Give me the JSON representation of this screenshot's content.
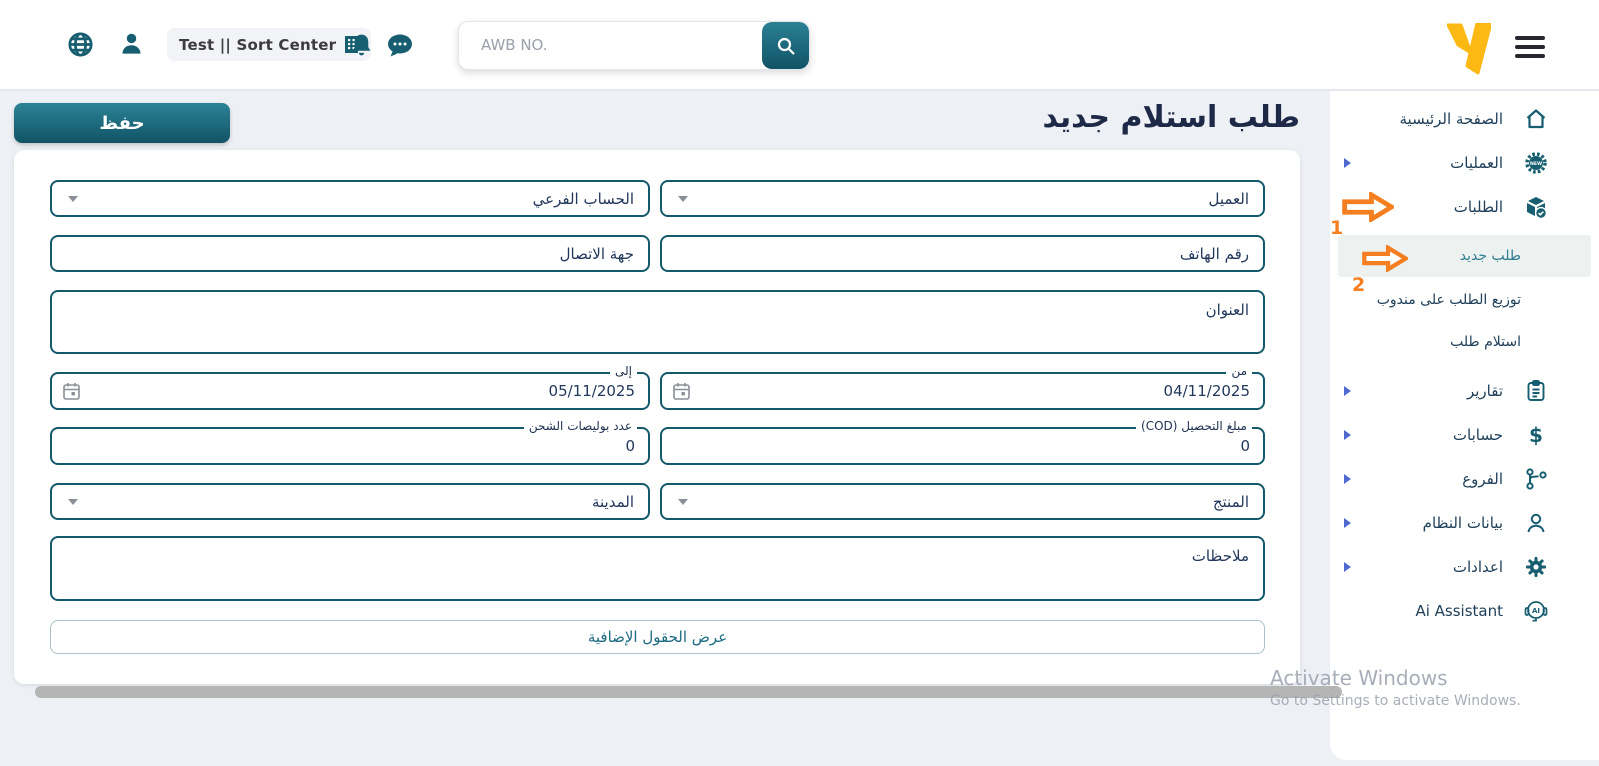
{
  "topbar": {
    "workspace_chip": "Test || Sort Center",
    "search": {
      "placeholder": "AWB NO."
    }
  },
  "page": {
    "title": "طلب استلام جديد",
    "save_label": "حفظ"
  },
  "sidebar": {
    "items": [
      {
        "label": "الصفحة الرئيسية",
        "icon": "home"
      },
      {
        "label": "العمليات",
        "icon": "operations-badge"
      },
      {
        "label": "الطلبات",
        "icon": "orders-box"
      },
      {
        "label": "طلب جديد",
        "selected": true
      },
      {
        "label": "توزيع الطلب على مندوب"
      },
      {
        "label": "استلام طلب"
      },
      {
        "label": "تقارير",
        "icon": "reports-clipboard"
      },
      {
        "label": "حسابات",
        "icon": "dollar"
      },
      {
        "label": "الفروع",
        "icon": "branches"
      },
      {
        "label": "بيانات النظام",
        "icon": "person"
      },
      {
        "label": "اعدادات",
        "icon": "gear"
      },
      {
        "label": "Ai Assistant",
        "icon": "ai-headset"
      }
    ]
  },
  "form": {
    "client": {
      "placeholder": "العميل"
    },
    "sub_account": {
      "placeholder": "الحساب الفرعي"
    },
    "phone": {
      "placeholder": "رقم الهاتف"
    },
    "contact": {
      "placeholder": "جهة الاتصال"
    },
    "address": {
      "placeholder": "العنوان"
    },
    "from": {
      "label": "من",
      "value": "04/11/2025"
    },
    "to": {
      "label": "إلى",
      "value": "05/11/2025"
    },
    "cod": {
      "label": "مبلغ التحصيل (COD)",
      "value": "0"
    },
    "bills": {
      "label": "عدد بوليصات الشحن",
      "value": "0"
    },
    "product": {
      "placeholder": "المنتج"
    },
    "city": {
      "placeholder": "المدينة"
    },
    "notes": {
      "placeholder": "ملاحظات"
    },
    "show_additional_fields": "عرض الحقول الإضافية"
  },
  "annotations": {
    "arrow1": "1",
    "arrow2": "2"
  },
  "watermark": {
    "line1": "Activate Windows",
    "line2": "Go to Settings to activate Windows."
  },
  "colors": {
    "accent": "#175e70",
    "accent_dark": "#115366",
    "title": "#1e2947",
    "annotation_orange": "#f57f20",
    "logo_yellow": "#fdb913",
    "selected_item_bg": "#edf1f0"
  }
}
